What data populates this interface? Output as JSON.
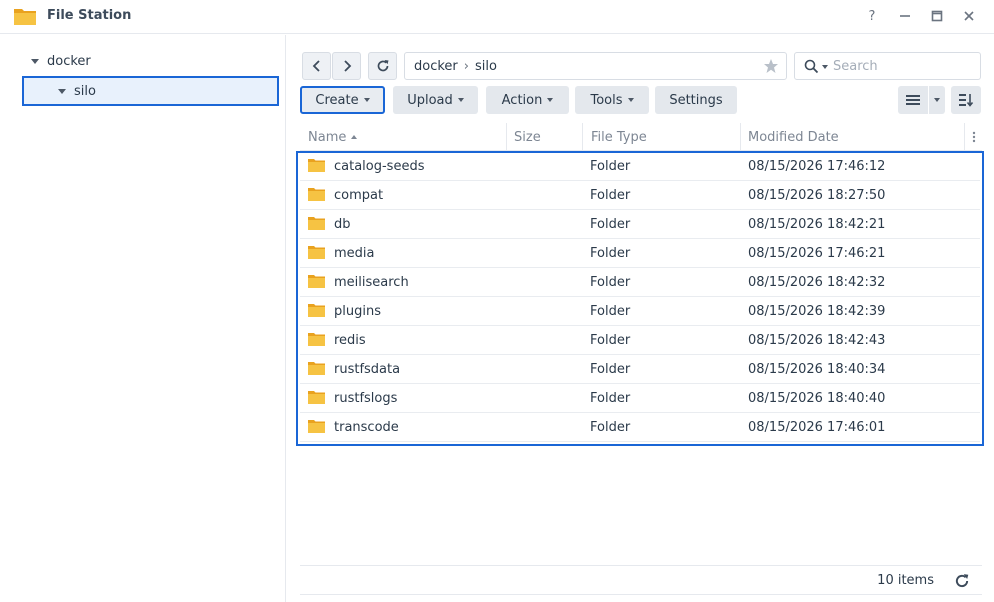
{
  "app": {
    "title": "File Station"
  },
  "window_controls": {
    "help": "?",
    "minimize": "—",
    "maximize": "□",
    "close": "✕"
  },
  "sidebar": {
    "items": [
      {
        "label": "docker",
        "expanded": true
      },
      {
        "label": "silo",
        "expanded": true,
        "selected": true
      }
    ]
  },
  "path": {
    "segments": [
      "docker",
      "silo"
    ],
    "separator": "›"
  },
  "search": {
    "placeholder": "Search",
    "value": ""
  },
  "toolbar": {
    "create": "Create",
    "upload": "Upload",
    "action": "Action",
    "tools": "Tools",
    "settings": "Settings"
  },
  "table": {
    "columns": [
      "Name",
      "Size",
      "File Type",
      "Modified Date"
    ],
    "sort": {
      "column": "Name",
      "direction": "ascending"
    },
    "rows": [
      {
        "name": "catalog-seeds",
        "size": "",
        "type": "Folder",
        "modified": "08/15/2026 17:46:12"
      },
      {
        "name": "compat",
        "size": "",
        "type": "Folder",
        "modified": "08/15/2026 18:27:50"
      },
      {
        "name": "db",
        "size": "",
        "type": "Folder",
        "modified": "08/15/2026 18:42:21"
      },
      {
        "name": "media",
        "size": "",
        "type": "Folder",
        "modified": "08/15/2026 17:46:21"
      },
      {
        "name": "meilisearch",
        "size": "",
        "type": "Folder",
        "modified": "08/15/2026 18:42:32"
      },
      {
        "name": "plugins",
        "size": "",
        "type": "Folder",
        "modified": "08/15/2026 18:42:39"
      },
      {
        "name": "redis",
        "size": "",
        "type": "Folder",
        "modified": "08/15/2026 18:42:43"
      },
      {
        "name": "rustfsdata",
        "size": "",
        "type": "Folder",
        "modified": "08/15/2026 18:40:34"
      },
      {
        "name": "rustfslogs",
        "size": "",
        "type": "Folder",
        "modified": "08/15/2026 18:40:40"
      },
      {
        "name": "transcode",
        "size": "",
        "type": "Folder",
        "modified": "08/15/2026 17:46:01"
      }
    ]
  },
  "footer": {
    "item_count": "10 items"
  },
  "colors": {
    "accent": "#1a66d6",
    "folder": "#f6c343",
    "selection_bg": "#e8f1fc"
  },
  "icons": [
    "folder-app-icon",
    "help-icon",
    "minimize-icon",
    "maximize-icon",
    "close-icon",
    "back-icon",
    "forward-icon",
    "refresh-icon",
    "star-icon",
    "search-icon",
    "list-view-icon",
    "sort-icon",
    "folder-icon",
    "more-vertical-icon"
  ]
}
